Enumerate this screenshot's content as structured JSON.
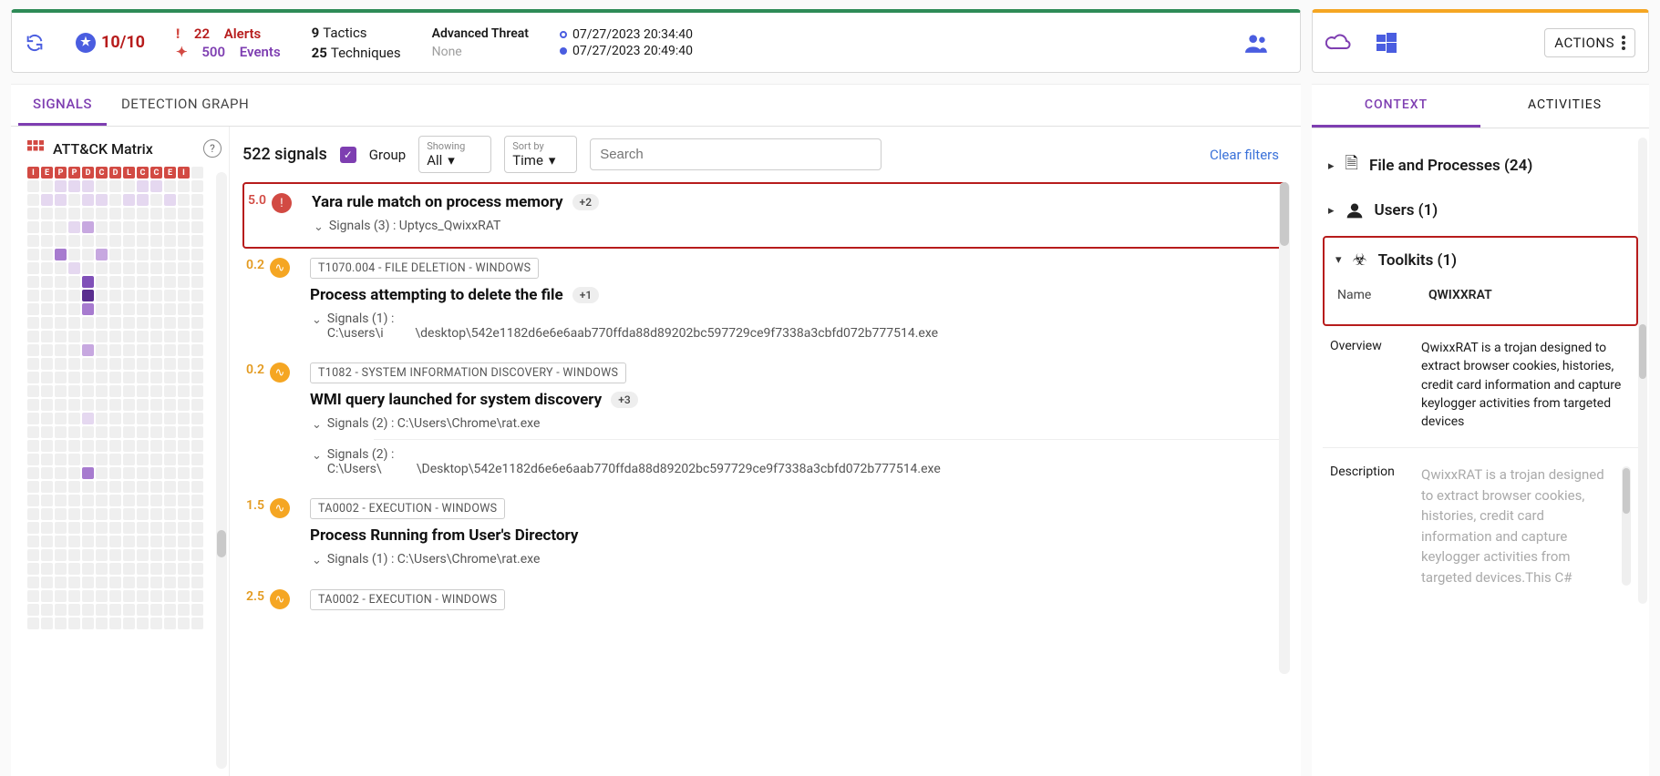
{
  "header": {
    "score": "10/10",
    "alerts_count": "22",
    "alerts_label": "Alerts",
    "events_count": "500",
    "events_label": "Events",
    "tactics_count": "9",
    "tactics_label": "Tactics",
    "techniques_count": "25",
    "techniques_label": "Techniques",
    "threat_label": "Advanced Threat",
    "threat_value": "None",
    "time_start": "07/27/2023 20:34:40",
    "time_end": "07/27/2023 20:49:40",
    "actions_label": "ACTIONS"
  },
  "tabs": {
    "signals": "SIGNALS",
    "detection_graph": "DETECTION GRAPH"
  },
  "matrix": {
    "title": "ATT&CK Matrix",
    "headers": [
      "I",
      "E",
      "P",
      "P",
      "D",
      "C",
      "D",
      "L",
      "C",
      "C",
      "E",
      "I",
      ""
    ]
  },
  "toolbar": {
    "count": "522 signals",
    "group_label": "Group",
    "showing_label": "Showing",
    "showing_value": "All",
    "sortby_label": "Sort by",
    "sortby_value": "Time",
    "search_placeholder": "Search",
    "clear": "Clear filters"
  },
  "signals": [
    {
      "score": "5.0",
      "sev": "red",
      "title": "Yara rule match on process memory",
      "badge": "+2",
      "sub": "Signals (3) : Uptycs_QwixxRAT",
      "highlight": true
    },
    {
      "score": "0.2",
      "sev": "orange",
      "tag": "T1070.004 - FILE DELETION - WINDOWS",
      "title": "Process attempting to delete the file",
      "badge": "+1",
      "sub_label": "Signals (1) :",
      "sub_path": "C:\\users\\i          \\desktop\\542e1182d6e6e6aab770ffda88d89202bc597729ce9f7338a3cbfd072b777514.exe"
    },
    {
      "score": "0.2",
      "sev": "orange",
      "tag": "T1082 - SYSTEM INFORMATION DISCOVERY - WINDOWS",
      "title": "WMI query launched for system discovery",
      "badge": "+3",
      "sub": "Signals (2) : C:\\Users\\Chrome\\rat.exe",
      "sub2_label": "Signals (2) :",
      "sub2_path": "C:\\Users\\           \\Desktop\\542e1182d6e6e6aab770ffda88d89202bc597729ce9f7338a3cbfd072b777514.exe"
    },
    {
      "score": "1.5",
      "sev": "orange",
      "tag": "TA0002 - EXECUTION - WINDOWS",
      "title": "Process Running from User's Directory",
      "sub": "Signals (1) : C:\\Users\\Chrome\\rat.exe"
    },
    {
      "score": "2.5",
      "sev": "orange",
      "tag": "TA0002 - EXECUTION - WINDOWS"
    }
  ],
  "rtabs": {
    "context": "CONTEXT",
    "activities": "ACTIVITIES"
  },
  "context": {
    "files": "File and Processes (24)",
    "users": "Users (1)",
    "toolkits": "Toolkits (1)",
    "name_k": "Name",
    "name_v": "QWIXXRAT",
    "overview_k": "Overview",
    "overview_v": "QwixxRAT is a trojan designed to extract browser cookies, histories, credit card information and capture keylogger activities from targeted devices",
    "desc_k": "Description",
    "desc_v": "QwixxRAT is a trojan designed to extract browser cookies, histories, credit card information and capture keylogger activities from targeted devices.This C#"
  }
}
